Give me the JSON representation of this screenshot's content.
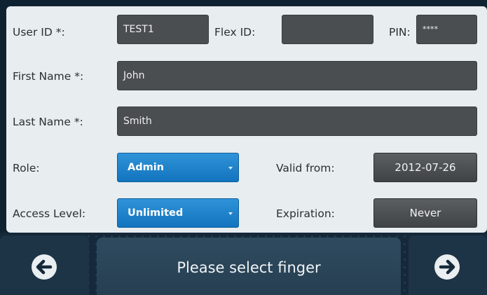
{
  "form": {
    "user_id_label": "User ID *:",
    "user_id_value": "TEST1",
    "flex_id_label": "Flex ID:",
    "flex_id_value": "",
    "pin_label": "PIN:",
    "pin_value": "****",
    "first_name_label": "First Name *:",
    "first_name_value": "John",
    "last_name_label": "Last Name *:",
    "last_name_value": "Smith",
    "role_label": "Role:",
    "role_value": "Admin",
    "valid_from_label": "Valid from:",
    "valid_from_value": "2012-07-26",
    "access_level_label": "Access Level:",
    "access_level_value": "Unlimited",
    "expiration_label": "Expiration:",
    "expiration_value": "Never"
  },
  "bottom_bar": {
    "prompt": "Please select finger",
    "back_icon": "arrow-left-icon",
    "next_icon": "arrow-right-icon"
  },
  "colors": {
    "panel": "#e8edf0",
    "field": "#4b4e51",
    "select_accent": "#1e83cc",
    "background": "#15293a"
  }
}
